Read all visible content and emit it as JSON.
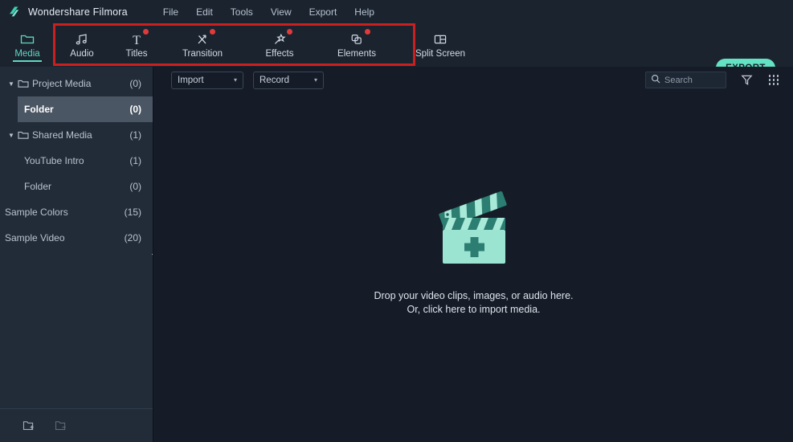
{
  "app": {
    "logo_icon": "filmora-logo-icon",
    "title": "Wondershare Filmora",
    "accent_color": "#5fd9c0",
    "annotation_color": "#cc1f1f",
    "badge_color": "#e23a3a"
  },
  "menubar": {
    "items": [
      {
        "label": "File"
      },
      {
        "label": "Edit"
      },
      {
        "label": "Tools"
      },
      {
        "label": "View"
      },
      {
        "label": "Export"
      },
      {
        "label": "Help"
      }
    ]
  },
  "tabs": [
    {
      "label": "Media",
      "icon": "folder-icon",
      "active": true,
      "badge": false
    },
    {
      "label": "Audio",
      "icon": "music-note-icon",
      "active": false,
      "badge": false
    },
    {
      "label": "Titles",
      "icon": "text-t-icon",
      "active": false,
      "badge": true
    },
    {
      "label": "Transition",
      "icon": "transition-arrows-icon",
      "active": false,
      "badge": true
    },
    {
      "label": "Effects",
      "icon": "magic-wand-icon",
      "active": false,
      "badge": true
    },
    {
      "label": "Elements",
      "icon": "stacked-squares-icon",
      "active": false,
      "badge": true
    },
    {
      "label": "Split Screen",
      "icon": "split-screen-icon",
      "active": false,
      "badge": false
    }
  ],
  "export_button": {
    "label": "EXPORT"
  },
  "sidebar": {
    "items": [
      {
        "label": "Project Media",
        "count": "(0)",
        "level": 0,
        "caret": "▼",
        "folder": true,
        "selected": false
      },
      {
        "label": "Folder",
        "count": "(0)",
        "level": 1,
        "caret": "",
        "folder": false,
        "selected": true
      },
      {
        "label": "Shared Media",
        "count": "(1)",
        "level": 0,
        "caret": "▼",
        "folder": true,
        "selected": false
      },
      {
        "label": "YouTube Intro",
        "count": "(1)",
        "level": 1,
        "caret": "",
        "folder": false,
        "selected": false
      },
      {
        "label": "Folder",
        "count": "(0)",
        "level": 1,
        "caret": "",
        "folder": false,
        "selected": false
      },
      {
        "label": "Sample Colors",
        "count": "(15)",
        "level": 0,
        "caret": "",
        "folder": false,
        "selected": false
      },
      {
        "label": "Sample Video",
        "count": "(20)",
        "level": 0,
        "caret": "",
        "folder": false,
        "selected": false
      }
    ],
    "footer": {
      "add_folder_icon": "add-folder-icon",
      "remove_folder_icon": "remove-folder-icon"
    },
    "collapse_icon": "collapse-panel-icon"
  },
  "toolbar": {
    "import_label": "Import",
    "record_label": "Record",
    "chevron": "▾",
    "search_placeholder": "Search",
    "search_value": "",
    "search_icon": "search-icon",
    "filter_icon": "filter-funnel-icon",
    "grid_icon": "grid-view-icon"
  },
  "dropzone": {
    "icon": "clapperboard-add-icon",
    "line1": "Drop your video clips, images, or audio here.",
    "line2": "Or, click here to import media."
  }
}
